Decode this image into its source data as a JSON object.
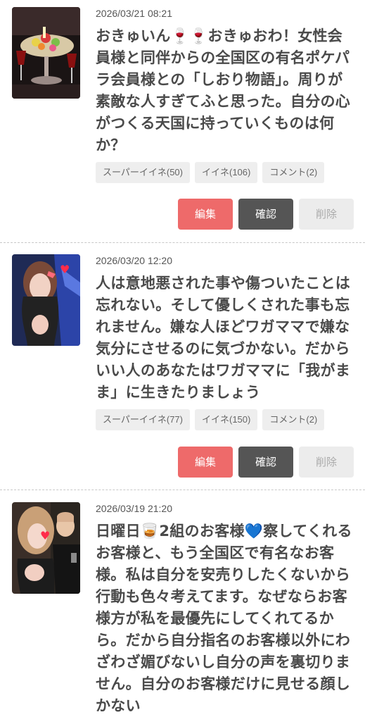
{
  "posts": [
    {
      "date": "2026/03/21 08:21",
      "text": "おきゅいん🍷🍷おきゅおわ！女性会員様と同伴からの全国区の有名ポケパラ会員様との「しおり物語」。周りが素敵な人すぎてふと思った。自分の心がつくる天国に持っていくものは何か？",
      "super_like": "スーパーイイネ(50)",
      "like": "イイネ(106)",
      "comment": "コメント(2)",
      "edit": "編集",
      "confirm": "確認",
      "delete": "削除"
    },
    {
      "date": "2026/03/20 12:20",
      "text": "人は意地悪された事や傷ついたことは忘れない。そして優しくされた事も忘れません。嫌な人ほどワガママで嫌な気分にさせるのに気づかない。だからいい人のあなたはワガママに「我がまま」に生きたりましょう",
      "super_like": "スーパーイイネ(77)",
      "like": "イイネ(150)",
      "comment": "コメント(2)",
      "edit": "編集",
      "confirm": "確認",
      "delete": "削除"
    },
    {
      "date": "2026/03/19 21:20",
      "text": "日曜日🥃2組のお客様💙察してくれるお客様と、もう全国区で有名なお客様。私は自分を安売りしたくないから行動も色々考えてます。なぜならお客様方が私を最優先にしてくれてるから。だから自分指名のお客様以外にわざわざ媚びないし自分の声を裏切りません。自分のお客様だけに見せる顔しかない"
    }
  ]
}
